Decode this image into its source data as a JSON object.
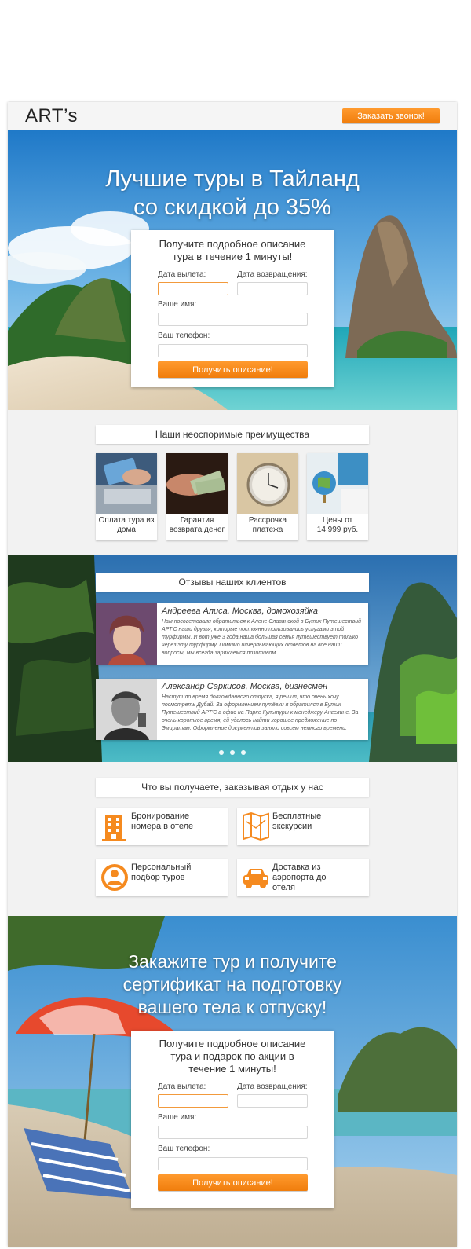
{
  "header": {
    "logo": "ART’s",
    "callback_button": "Заказать звонок!"
  },
  "hero": {
    "title_line1": "Лучшие туры в Тайланд",
    "title_line2": "со скидкой до 35%",
    "form": {
      "heading_line1": "Получите подробное описание",
      "heading_line2": "тура в течение 1 минуты!",
      "departure_label": "Дата вылета:",
      "return_label": "Дата возвращения:",
      "name_label": "Ваше имя:",
      "phone_label": "Ваш телефон:",
      "submit": "Получить описание!"
    }
  },
  "advantages": {
    "heading": "Наши неоспоримые преимущества",
    "items": [
      {
        "line1": "Оплата тура из",
        "line2": "дома"
      },
      {
        "line1": "Гарантия",
        "line2": "возврата денег"
      },
      {
        "line1": "Рассрочка",
        "line2": "платежа"
      },
      {
        "line1": "Цены от",
        "line2": "14 999 руб."
      }
    ]
  },
  "reviews": {
    "heading": "Отзывы наших клиентов",
    "items": [
      {
        "name": "Андреева Алиса, Москва, домохозяйка",
        "text": "Нам посоветовали обратиться к Алене Славянской в Бутик Путешествий АРТ'С наши друзья, которые постоянно пользовались услугами этой турфирмы. И вот уже 3 года наша большая семья путешествует только через эту турфирму. Помимо исчерпывающих ответов на все наши вопросы, мы всегда заряжаемся позитивом."
      },
      {
        "name": "Александр Саркисов, Москва, бизнесмен",
        "text": "Наступило время долгожданного отпуска, я решил, что очень хочу посмотреть Дубай. За оформлением путёвки я обратился в Бутик Путешествий АРТ'С в офис на Парке Культуры к менеджеру Ангелине. За очень короткое время, ей удалось найти хорошее предложение по Эмиратам. Оформление документов заняло совсем немного времени."
      }
    ]
  },
  "benefits": {
    "heading": "Что вы получаете, заказывая отдых у нас",
    "items": [
      {
        "icon": "hotel-building-icon",
        "line1": "Бронирование",
        "line2": "номера в отеле",
        "line3": ""
      },
      {
        "icon": "map-excursion-icon",
        "line1": "Бесплатные",
        "line2": "экскурсии",
        "line3": ""
      },
      {
        "icon": "personal-manager-icon",
        "line1": "Персональный",
        "line2": "подбор туров",
        "line3": ""
      },
      {
        "icon": "taxi-car-icon",
        "line1": "Доставка из",
        "line2": "аэропорта до",
        "line3": "отеля"
      }
    ]
  },
  "bottom": {
    "title_line1": "Закажите тур и получите",
    "title_line2": "сертификат на подготовку",
    "title_line3": "вашего тела к отпуску!",
    "form": {
      "heading_line1": "Получите подробное описание",
      "heading_line2": "тура и подарок по акции в",
      "heading_line3": "течение 1 минуты!",
      "departure_label": "Дата вылета:",
      "return_label": "Дата возвращения:",
      "name_label": "Ваше имя:",
      "phone_label": "Ваш телефон:",
      "submit": "Получить описание!"
    }
  },
  "colors": {
    "accent": "#f58a1f",
    "page_bg": "#f2f2f2"
  }
}
